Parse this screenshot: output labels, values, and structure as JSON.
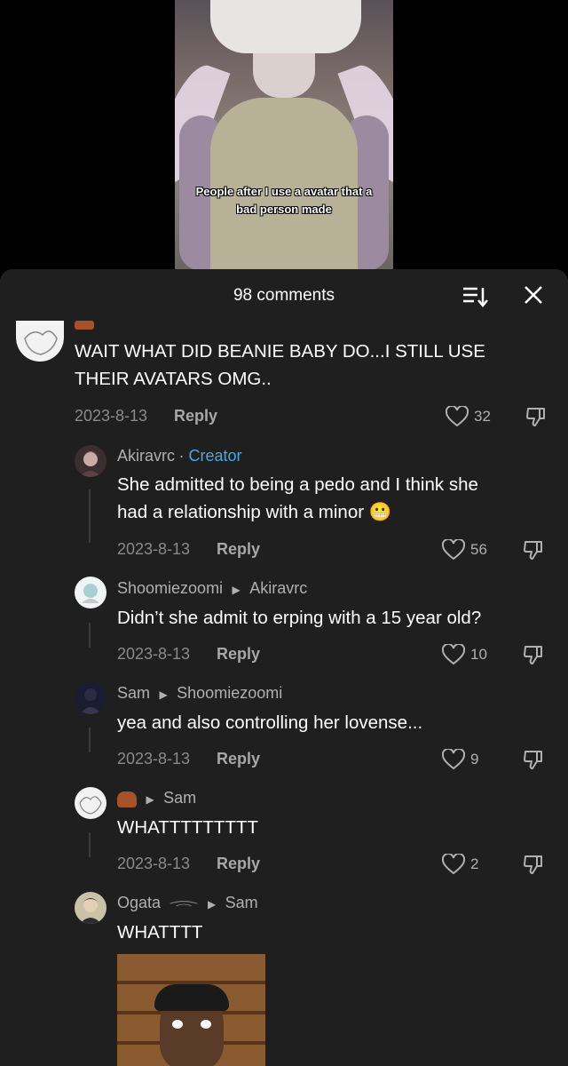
{
  "video": {
    "caption_line1": "People after I use a avatar that a",
    "caption_line2": "bad person made"
  },
  "sheet": {
    "title": "98 comments"
  },
  "comments": [
    {
      "author": "",
      "text_line1": "WAIT WHAT DID BEANIE BABY DO...I STILL USE",
      "text_line2": "THEIR AVATARS OMG..",
      "date": "2023-8-13",
      "reply": "Reply",
      "likes": "32"
    },
    {
      "author": "Akiravrc",
      "badge": "Creator",
      "text_line1": "She admitted to being a pedo and I think she",
      "text_line2": "had a relationship with a minor",
      "emoji": "😬",
      "date": "2023-8-13",
      "reply": "Reply",
      "likes": "56"
    },
    {
      "author": "Shoomiezoomi",
      "reply_to": "Akiravrc",
      "text": "Didn’t she admit to erping with a 15 year old?",
      "date": "2023-8-13",
      "reply": "Reply",
      "likes": "10"
    },
    {
      "author": "Sam",
      "reply_to": "Shoomiezoomi",
      "text": "yea and also controlling her lovense...",
      "date": "2023-8-13",
      "reply": "Reply",
      "likes": "9"
    },
    {
      "author": "",
      "reply_to": "Sam",
      "text": "WHATTTTTTTTT",
      "date": "2023-8-13",
      "reply": "Reply",
      "likes": "2"
    },
    {
      "author": "Ogata",
      "reply_to": "Sam",
      "text": "WHATTTT"
    }
  ],
  "colors": {
    "sheet_bg": "#1f1f1f",
    "creator_accent": "#4aa8e0",
    "muted": "#8a8a8a"
  },
  "icons": [
    "sort-icon",
    "close-icon",
    "heart-icon",
    "dislike-icon",
    "reply-arrow-icon"
  ]
}
